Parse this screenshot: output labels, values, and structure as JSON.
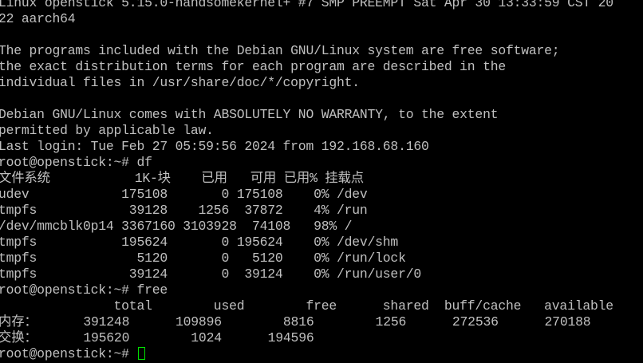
{
  "terminal": {
    "lines": [
      "Linux openstick 5.15.0-handsomekernel+ #7 SMP PREEMPT Sat Apr 30 13:33:59 CST 20",
      "22 aarch64",
      "",
      "The programs included with the Debian GNU/Linux system are free software;",
      "the exact distribution terms for each program are described in the",
      "individual files in /usr/share/doc/*/copyright.",
      "",
      "Debian GNU/Linux comes with ABSOLUTELY NO WARRANTY, to the extent",
      "permitted by applicable law.",
      "Last login: Tue Feb 27 05:59:56 2024 from 192.168.68.160",
      "root@openstick:~# df",
      "文件系统           1K-块    已用   可用 已用% 挂载点",
      "udev            175108       0 175108    0% /dev",
      "tmpfs            39128    1256  37872    4% /run",
      "/dev/mmcblk0p14 3367160 3103928  74108   98% /",
      "tmpfs           195624       0 195624    0% /dev/shm",
      "tmpfs             5120       0   5120    0% /run/lock",
      "tmpfs            39124       0  39124    0% /run/user/0",
      "root@openstick:~# free",
      "               total        used        free      shared  buff/cache   available",
      "内存：      391248      109896        8816        1256      272536      270188",
      "交换：      195620        1024      194596"
    ],
    "prompt": "root@openstick:~# "
  },
  "colors": {
    "background": "#000000",
    "foreground": "#c0c0c0",
    "cursor": "#00e000"
  }
}
